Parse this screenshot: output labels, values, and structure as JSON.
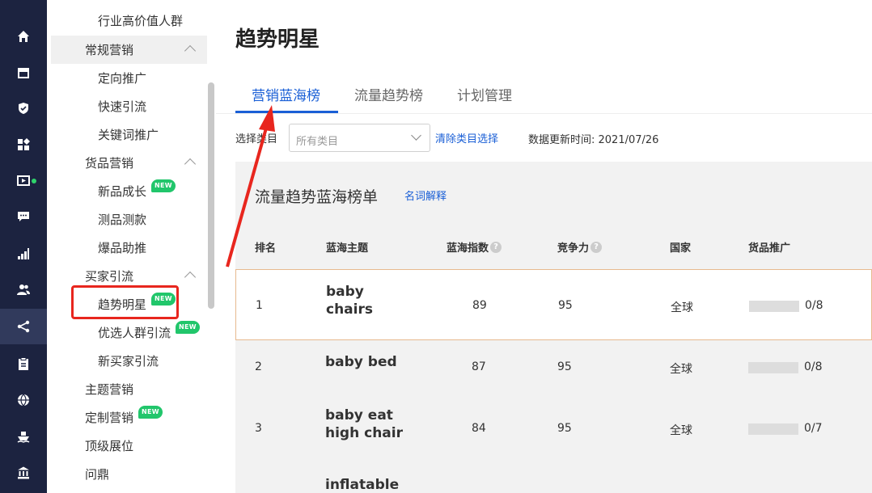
{
  "rail": {
    "icons": [
      "home-icon",
      "shop-icon",
      "shield-icon",
      "apps-icon",
      "media-icon",
      "message-icon",
      "chart-icon",
      "users-icon",
      "marketing-icon",
      "clipboard-icon",
      "globe-icon",
      "ship-icon",
      "bank-icon"
    ]
  },
  "sidebar": {
    "items": [
      {
        "label": "行业高价值人群",
        "level": "sub"
      },
      {
        "label": "常规营销",
        "level": "group",
        "collapsible": true,
        "highlight": true
      },
      {
        "label": "定向推广",
        "level": "sub"
      },
      {
        "label": "快速引流",
        "level": "sub"
      },
      {
        "label": "关键词推广",
        "level": "sub"
      },
      {
        "label": "货品营销",
        "level": "group",
        "collapsible": true
      },
      {
        "label": "新品成长",
        "level": "sub",
        "badge": "NEW"
      },
      {
        "label": "测品测款",
        "level": "sub"
      },
      {
        "label": "爆品助推",
        "level": "sub"
      },
      {
        "label": "买家引流",
        "level": "group",
        "collapsible": true
      },
      {
        "label": "趋势明星",
        "level": "sub",
        "badge": "NEW",
        "active": true
      },
      {
        "label": "优选人群引流",
        "level": "sub",
        "badge": "NEW"
      },
      {
        "label": "新买家引流",
        "level": "sub"
      },
      {
        "label": "主题营销",
        "level": "group"
      },
      {
        "label": "定制营销",
        "level": "group",
        "badge": "NEW"
      },
      {
        "label": "顶级展位",
        "level": "group"
      },
      {
        "label": "问鼎",
        "level": "group"
      }
    ]
  },
  "page": {
    "title": "趋势明星",
    "tabs": [
      {
        "label": "营销蓝海榜",
        "active": true
      },
      {
        "label": "流量趋势榜",
        "active": false
      },
      {
        "label": "计划管理",
        "active": false
      }
    ],
    "filter": {
      "label": "选择类目",
      "select_value": "所有类目",
      "clear_link": "清除类目选择",
      "update_time": "数据更新时间: 2021/07/26"
    },
    "panel": {
      "title": "流量趋势蓝海榜单",
      "glossary_link": "名词解释",
      "columns": [
        "排名",
        "蓝海主题",
        "蓝海指数",
        "竞争力",
        "国家",
        "货品推广"
      ],
      "rows": [
        {
          "rank": "1",
          "topic": "baby chairs",
          "index": "89",
          "competition": "95",
          "country": "全球",
          "promo": "0/8",
          "promo_fraction": 0
        },
        {
          "rank": "2",
          "topic": "baby bed",
          "index": "87",
          "competition": "95",
          "country": "全球",
          "promo": "0/8",
          "promo_fraction": 0
        },
        {
          "rank": "3",
          "topic": "baby eat high chair",
          "index": "84",
          "competition": "95",
          "country": "全球",
          "promo": "0/7",
          "promo_fraction": 0
        },
        {
          "rank": "",
          "topic": "inflatable",
          "index": "",
          "competition": "",
          "country": "",
          "promo": "",
          "promo_fraction": 0
        }
      ]
    }
  },
  "colors": {
    "rail_bg": "#1c2340",
    "accent": "#1a5fd6",
    "badge": "#21c66b",
    "annotation": "#e8261e"
  }
}
